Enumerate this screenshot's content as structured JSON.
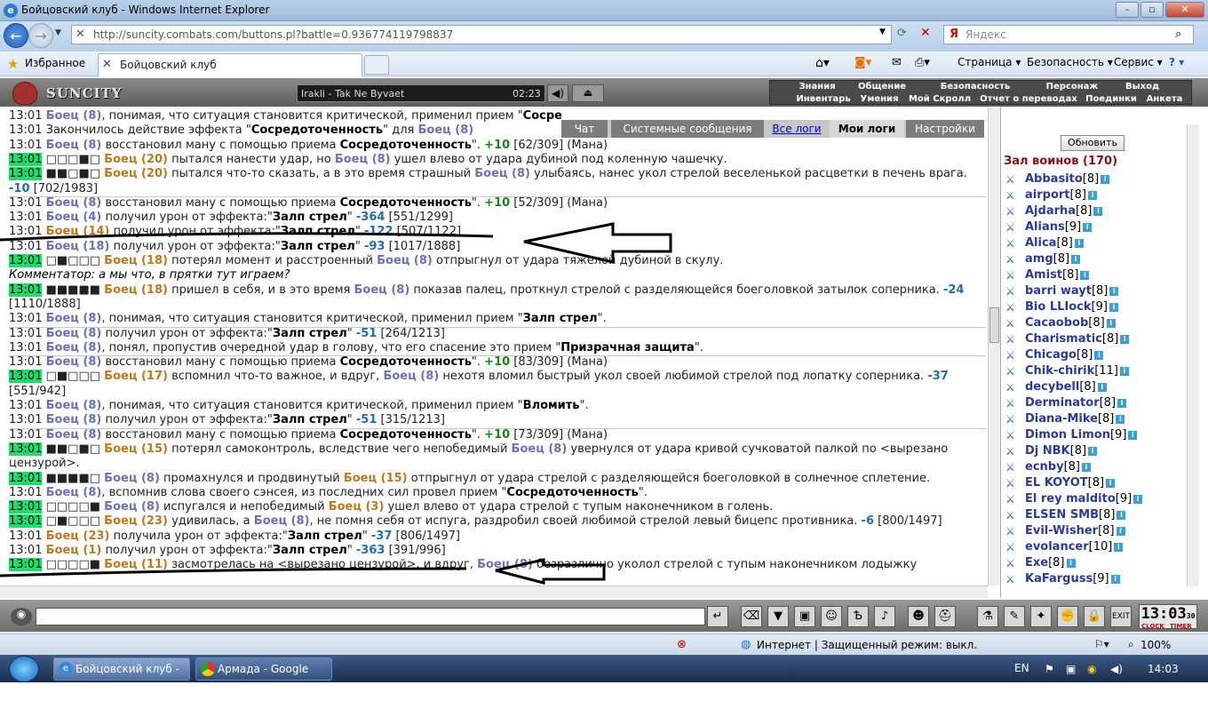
{
  "window": {
    "title": "Бойцовский клуб - Windows Internet Explorer"
  },
  "browser": {
    "url": "http://suncity.combats.com/buttons.pl?battle=0.936774119798837",
    "search_placeholder": "Яндекс",
    "favorites_label": "Избранное",
    "tab_title": "Бойцовский клуб",
    "cmd_page": "Страница ▾",
    "cmd_security": "Безопасность ▾",
    "cmd_service": "Сервис ▾",
    "help": "? ▾"
  },
  "game": {
    "logo_text": "SUNCITY",
    "track": "Irakli - Tak Ne Byvaet",
    "track_time": "02:23",
    "menu_top": [
      "Знания",
      "Общение",
      "Безопасность",
      "Персонаж",
      "Выход"
    ],
    "menu_sub": [
      "Инвентарь",
      "Умения",
      "Мой Скролл",
      "Отчет о переводах",
      "Поединки",
      "Анкета"
    ]
  },
  "chat_tabs": [
    "Чат",
    "Системные сообщения",
    "Все логи",
    "Мои логи",
    "Настройки"
  ],
  "log_lines": [
    {
      "time": "13:01",
      "g": false,
      "parts": [
        [
          "nb",
          "Боец (8)"
        ],
        [
          "t",
          ", понимая, что ситуация становится критической, применил прием \""
        ],
        [
          "b",
          "Сосре"
        ]
      ]
    },
    {
      "time": "13:01",
      "g": false,
      "parts": [
        [
          "t",
          "Закончилось действие эффекта \""
        ],
        [
          "b",
          "Сосредоточенность"
        ],
        [
          "t",
          "\" для "
        ],
        [
          "nb",
          "Боец (8)"
        ]
      ]
    },
    {
      "time": "13:01",
      "g": false,
      "parts": [
        [
          "nb",
          "Боец (8)"
        ],
        [
          "t",
          " восстановил ману с помощью приема "
        ],
        [
          "b",
          "Сосредоточенность"
        ],
        [
          "t",
          "\". "
        ],
        [
          "plus",
          "+10"
        ],
        [
          "t",
          " [62/309] (Мана)"
        ]
      ]
    },
    {
      "time": "13:01",
      "g": true,
      "parts": [
        [
          "t",
          "□□□■□ "
        ],
        [
          "no",
          "Боец (20)"
        ],
        [
          "t",
          " пытался нанести удар, но "
        ],
        [
          "nb",
          "Боец (8)"
        ],
        [
          "t",
          " ушел влево от удара дубиной под коленную чашечку."
        ]
      ]
    },
    {
      "time": "13:01",
      "g": true,
      "parts": [
        [
          "t",
          "■■□■□ "
        ],
        [
          "no",
          "Боец (20)"
        ],
        [
          "t",
          " пытался что-то сказать, а в это время страшный "
        ],
        [
          "nb",
          "Боец (8)"
        ],
        [
          "t",
          " улыбаясь, нанес укол стрелой веселенькой расцветки в печень врага."
        ]
      ]
    },
    {
      "time": "",
      "g": false,
      "parts": [
        [
          "num",
          "-10"
        ],
        [
          "t",
          " [702/1983]"
        ]
      ]
    },
    {
      "time": "13:01",
      "g": false,
      "parts": [
        [
          "nb",
          "Боец (8)"
        ],
        [
          "t",
          " восстановил ману с помощью приема "
        ],
        [
          "b",
          "Сосредоточенность"
        ],
        [
          "t",
          "\". "
        ],
        [
          "plus",
          "+10"
        ],
        [
          "t",
          " [52/309] (Мана)"
        ]
      ]
    },
    {
      "time": "13:01",
      "g": false,
      "parts": [
        [
          "nb",
          "Боец (4)"
        ],
        [
          "t",
          " получил урон от эффекта:\""
        ],
        [
          "b",
          "Залп стрел"
        ],
        [
          "t",
          "\" "
        ],
        [
          "num",
          "-364"
        ],
        [
          "t",
          " [551/1299]"
        ]
      ]
    },
    {
      "time": "13:01",
      "g": false,
      "parts": [
        [
          "no",
          "Боец (14)"
        ],
        [
          "t",
          " получил урон от эффекта:\""
        ],
        [
          "b",
          "Залп стрел"
        ],
        [
          "t",
          "\" "
        ],
        [
          "num",
          "-122"
        ],
        [
          "t",
          " [507/1122]"
        ]
      ]
    },
    {
      "time": "13:01",
      "g": false,
      "parts": [
        [
          "nb",
          "Боец (18)"
        ],
        [
          "t",
          " получил урон от эффекта:\""
        ],
        [
          "b",
          "Залп стрел"
        ],
        [
          "t",
          "\" "
        ],
        [
          "num",
          "-93"
        ],
        [
          "t",
          " [1017/1888]"
        ]
      ]
    },
    {
      "time": "13:01",
      "g": true,
      "parts": [
        [
          "t",
          "□■□□□ "
        ],
        [
          "no",
          "Боец (18)"
        ],
        [
          "t",
          " потерял момент и расстроенный "
        ],
        [
          "nb",
          "Боец (8)"
        ],
        [
          "t",
          " отпрыгнул от удара тяжелой дубиной в скулу."
        ]
      ]
    },
    {
      "time": "",
      "g": false,
      "parts": [
        [
          "cm",
          "Комментатор: а мы что, в прятки тут играем?"
        ]
      ]
    },
    {
      "time": "13:01",
      "g": true,
      "parts": [
        [
          "t",
          "■■■■■ "
        ],
        [
          "no",
          "Боец (18)"
        ],
        [
          "t",
          " пришел в себя, и в это время "
        ],
        [
          "nb",
          "Боец (8)"
        ],
        [
          "t",
          " показав палец, проткнул стрелой с разделяющейся боеголовкой затылок соперника. "
        ],
        [
          "num",
          "-24"
        ]
      ]
    },
    {
      "time": "",
      "g": false,
      "parts": [
        [
          "t",
          "[1110/1888]"
        ]
      ]
    },
    {
      "time": "13:01",
      "g": false,
      "parts": [
        [
          "nb",
          "Боец (8)"
        ],
        [
          "t",
          ", понимая, что ситуация становится критической, применил прием \""
        ],
        [
          "b",
          "Залп стрел"
        ],
        [
          "t",
          "\"."
        ]
      ]
    },
    {
      "time": "13:01",
      "g": false,
      "parts": [
        [
          "nb",
          "Боец (8)"
        ],
        [
          "t",
          " получил урон от эффекта:\""
        ],
        [
          "b",
          "Залп стрел"
        ],
        [
          "t",
          "\" "
        ],
        [
          "num",
          "-51"
        ],
        [
          "t",
          " [264/1213]"
        ]
      ]
    },
    {
      "time": "13:01",
      "g": false,
      "parts": [
        [
          "nb",
          "Боец (8)"
        ],
        [
          "t",
          ", понял, пропустив очередной удар в голову, что его спасение это прием \""
        ],
        [
          "b",
          "Призрачная защита"
        ],
        [
          "t",
          "\"."
        ]
      ]
    },
    {
      "time": "13:01",
      "g": false,
      "parts": [
        [
          "nb",
          "Боец (8)"
        ],
        [
          "t",
          " восстановил ману с помощью приема "
        ],
        [
          "b",
          "Сосредоточенность"
        ],
        [
          "t",
          "\". "
        ],
        [
          "plus",
          "+10"
        ],
        [
          "t",
          " [83/309] (Мана)"
        ]
      ]
    },
    {
      "time": "13:01",
      "g": true,
      "parts": [
        [
          "t",
          "□■□□□ "
        ],
        [
          "no",
          "Боец (17)"
        ],
        [
          "t",
          " вспомнил что-то важное, и вдруг, "
        ],
        [
          "nb",
          "Боец (8)"
        ],
        [
          "t",
          " нехотя вломил быстрый укол своей любимой стрелой под лопатку соперника. "
        ],
        [
          "num",
          "-37"
        ]
      ]
    },
    {
      "time": "",
      "g": false,
      "parts": [
        [
          "t",
          "[551/942]"
        ]
      ]
    },
    {
      "time": "13:01",
      "g": false,
      "parts": [
        [
          "nb",
          "Боец (8)"
        ],
        [
          "t",
          ", понимая, что ситуация становится критической, применил прием \""
        ],
        [
          "b",
          "Вломить"
        ],
        [
          "t",
          "\"."
        ]
      ]
    },
    {
      "time": "13:01",
      "g": false,
      "parts": [
        [
          "nb",
          "Боец (8)"
        ],
        [
          "t",
          " получил урон от эффекта:\""
        ],
        [
          "b",
          "Залп стрел"
        ],
        [
          "t",
          "\" "
        ],
        [
          "num",
          "-51"
        ],
        [
          "t",
          " [315/1213]"
        ]
      ]
    },
    {
      "time": "13:01",
      "g": false,
      "parts": [
        [
          "nb",
          "Боец (8)"
        ],
        [
          "t",
          " восстановил ману с помощью приема "
        ],
        [
          "b",
          "Сосредоточенность"
        ],
        [
          "t",
          "\". "
        ],
        [
          "plus",
          "+10"
        ],
        [
          "t",
          " [73/309] (Мана)"
        ]
      ]
    },
    {
      "time": "13:01",
      "g": true,
      "parts": [
        [
          "t",
          "■■□■□ "
        ],
        [
          "no",
          "Боец (15)"
        ],
        [
          "t",
          " потерял самоконтроль, вследствие чего непобедимый "
        ],
        [
          "nb",
          "Боец (8)"
        ],
        [
          "t",
          " увернулся от удара кривой сучковатой палкой по <вырезано"
        ]
      ]
    },
    {
      "time": "",
      "g": false,
      "parts": [
        [
          "t",
          "цензурой>."
        ]
      ]
    },
    {
      "time": "13:01",
      "g": true,
      "parts": [
        [
          "t",
          "■■■■□ "
        ],
        [
          "nb",
          "Боец (8)"
        ],
        [
          "t",
          " промахнулся и продвинутый "
        ],
        [
          "no",
          "Боец (15)"
        ],
        [
          "t",
          " отпрыгнул от удара стрелой с разделяющейся боеголовкой в солнечное сплетение."
        ]
      ]
    },
    {
      "time": "13:01",
      "g": false,
      "parts": [
        [
          "nb",
          "Боец (8)"
        ],
        [
          "t",
          ", вспомнив слова своего сэнсея, из последних сил провел прием \""
        ],
        [
          "b",
          "Сосредоточенность"
        ],
        [
          "t",
          "\"."
        ]
      ]
    },
    {
      "time": "13:01",
      "g": true,
      "parts": [
        [
          "t",
          "□□□□■ "
        ],
        [
          "nb",
          "Боец (8)"
        ],
        [
          "t",
          " испугался и непобедимый "
        ],
        [
          "no",
          "Боец (3)"
        ],
        [
          "t",
          " ушел влево от удара стрелой с тупым наконечником в голень."
        ]
      ]
    },
    {
      "time": "13:01",
      "g": true,
      "parts": [
        [
          "t",
          "□■□□□ "
        ],
        [
          "no",
          "Боец (23)"
        ],
        [
          "t",
          " удивилась, а "
        ],
        [
          "nb",
          "Боец (8)"
        ],
        [
          "t",
          ", не помня себя от испуга, раздробил своей любимой стрелой левый бицепс противника. "
        ],
        [
          "num",
          "-6"
        ],
        [
          "t",
          " [800/1497]"
        ]
      ]
    },
    {
      "time": "13:01",
      "g": false,
      "parts": [
        [
          "no",
          "Боец (23)"
        ],
        [
          "t",
          " получила урон от эффекта:\""
        ],
        [
          "b",
          "Залп стрел"
        ],
        [
          "t",
          "\" "
        ],
        [
          "num",
          "-37"
        ],
        [
          "t",
          " [806/1497]"
        ]
      ]
    },
    {
      "time": "13:01",
      "g": false,
      "parts": [
        [
          "no",
          "Боец (1)"
        ],
        [
          "t",
          " получил урон от эффекта:\""
        ],
        [
          "b",
          "Залп стрел"
        ],
        [
          "t",
          "\" "
        ],
        [
          "num",
          "-363"
        ],
        [
          "t",
          " [391/996]"
        ]
      ]
    },
    {
      "time": "13:01",
      "g": true,
      "parts": [
        [
          "t",
          "□□□□■ "
        ],
        [
          "no",
          "Боец (11)"
        ],
        [
          "t",
          " засмотрелась на <вырезано цензурой>, и вдруг, "
        ],
        [
          "nb",
          "Боец (8)"
        ],
        [
          "t",
          " безразлично уколол стрелой с тупым наконечником лодыжку"
        ]
      ]
    }
  ],
  "right_panel": {
    "refresh": "Обновить",
    "hall_title": "Зал воинов (170)",
    "users": [
      {
        "name": "Abbasito",
        "lvl": "[8]"
      },
      {
        "name": "airport",
        "lvl": "[8]"
      },
      {
        "name": "Ajdarha",
        "lvl": "[8]"
      },
      {
        "name": "Alians",
        "lvl": "[9]"
      },
      {
        "name": "Alica",
        "lvl": "[8]"
      },
      {
        "name": "amg",
        "lvl": "[8]"
      },
      {
        "name": "Amist",
        "lvl": "[8]"
      },
      {
        "name": "barri wayt",
        "lvl": "[8]"
      },
      {
        "name": "Bio LLIock",
        "lvl": "[9]"
      },
      {
        "name": "Cacaobob",
        "lvl": "[8]"
      },
      {
        "name": "Charismatic",
        "lvl": "[8]"
      },
      {
        "name": "Chicago",
        "lvl": "[8]"
      },
      {
        "name": "Chik-chirik",
        "lvl": "[11]"
      },
      {
        "name": "decybell",
        "lvl": "[8]"
      },
      {
        "name": "Derminator",
        "lvl": "[8]"
      },
      {
        "name": "Diana-Mike",
        "lvl": "[8]"
      },
      {
        "name": "Dimon Limon",
        "lvl": "[9]"
      },
      {
        "name": "Dj NBK",
        "lvl": "[8]"
      },
      {
        "name": "ecnby",
        "lvl": "[8]"
      },
      {
        "name": "EL KOYOT",
        "lvl": "[8]"
      },
      {
        "name": "El rey maldito",
        "lvl": "[9]"
      },
      {
        "name": "ELSEN SMB",
        "lvl": "[8]"
      },
      {
        "name": "Evil-Wisher",
        "lvl": "[8]"
      },
      {
        "name": "evolancer",
        "lvl": "[10]"
      },
      {
        "name": "Exe",
        "lvl": "[8]"
      },
      {
        "name": "KaFarguss",
        "lvl": "[9]"
      }
    ]
  },
  "bottom": {
    "clock": "13:03",
    "sec": "30",
    "clock_l": "CLOCK",
    "timer_l": "TIMER"
  },
  "status": {
    "zone": "Интернет | Защищенный режим: выкл.",
    "zoom": "100%"
  },
  "taskbar": {
    "items": [
      "Бойцовский клуб - ...",
      "Армада - Google Ch..."
    ],
    "lang": "EN",
    "time": "14:03"
  }
}
